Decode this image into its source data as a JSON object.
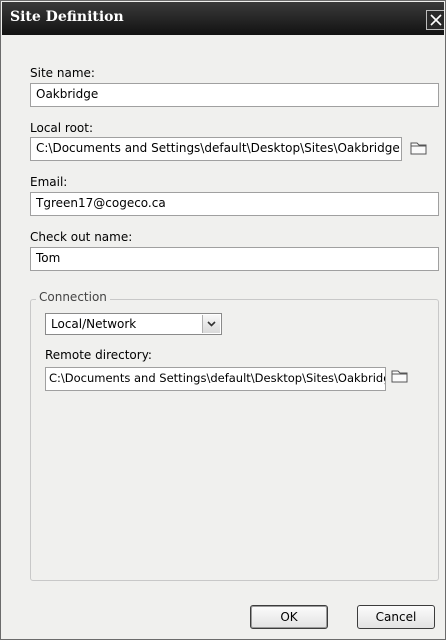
{
  "window": {
    "title": "Site Definition",
    "close_icon": "close-icon"
  },
  "form": {
    "site_name_label": "Site name:",
    "site_name_value": "Oakbridge",
    "local_root_label": "Local root:",
    "local_root_value": "C:\\Documents and Settings\\default\\Desktop\\Sites\\Oakbridge",
    "email_label": "Email:",
    "email_value": "Tgreen17@cogeco.ca",
    "checkout_label": "Check out name:",
    "checkout_value": "Tom"
  },
  "connection": {
    "group_label": "Connection",
    "type_value": "Local/Network",
    "remote_dir_label": "Remote directory:",
    "remote_dir_value": "C:\\Documents and Settings\\default\\Desktop\\Sites\\Oakbridge"
  },
  "buttons": {
    "ok_label": "OK",
    "cancel_label": "Cancel"
  },
  "icons": {
    "folder": "folder-icon",
    "dropdown": "chevron-down-icon"
  },
  "colors": {
    "titlebar": "#1e1e1e",
    "dialog_bg": "#f0f0ee"
  }
}
